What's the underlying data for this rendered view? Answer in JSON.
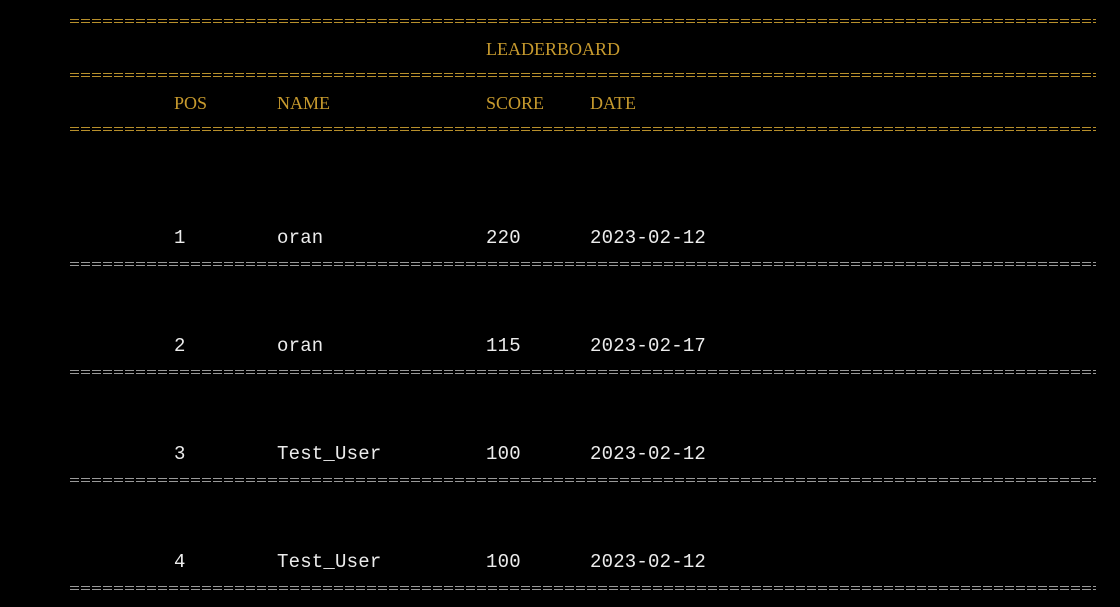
{
  "leaderboard": {
    "title": "LEADERBOARD",
    "headers": {
      "pos": "POS",
      "name": "NAME",
      "score": "SCORE",
      "date": "DATE"
    },
    "rows": [
      {
        "pos": "1",
        "name": "oran",
        "score": "220",
        "date": "2023-02-12"
      },
      {
        "pos": "2",
        "name": "oran",
        "score": "115",
        "date": "2023-02-17"
      },
      {
        "pos": "3",
        "name": "Test_User",
        "score": "100",
        "date": "2023-02-12"
      },
      {
        "pos": "4",
        "name": "Test_User",
        "score": "100",
        "date": "2023-02-12"
      }
    ]
  },
  "colors": {
    "background": "#000000",
    "accent": "#c79a2e",
    "text": "#ececec",
    "row_divider": "#9a9a9a"
  }
}
